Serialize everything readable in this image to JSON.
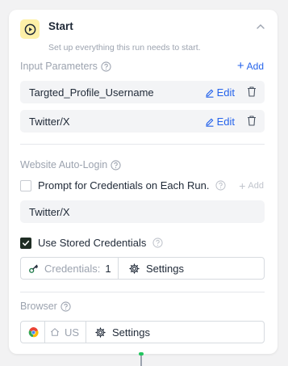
{
  "node": {
    "title": "Start",
    "subtitle": "Set up everything this run needs to start."
  },
  "input_parameters": {
    "label": "Input Parameters",
    "add_label": "Add",
    "items": [
      {
        "name": "Targted_Profile_Username",
        "edit_label": "Edit"
      },
      {
        "name": "Twitter/X",
        "edit_label": "Edit"
      }
    ]
  },
  "website_auto_login": {
    "label": "Website Auto-Login",
    "prompt_checkbox_label": "Prompt for Credentials on Each Run.",
    "prompt_checked": false,
    "add_label": "Add",
    "selected_site": "Twitter/X",
    "use_stored_label": "Use Stored Credentials",
    "use_stored_checked": true,
    "credentials_label": "Credentials:",
    "credentials_count": "1",
    "settings_label": "Settings"
  },
  "browser": {
    "label": "Browser",
    "region": "US",
    "settings_label": "Settings"
  },
  "colors": {
    "accent": "#2563eb",
    "start_icon_bg": "#fdf0a8",
    "checked": "#1f2d24",
    "connector": "#22c55e"
  }
}
